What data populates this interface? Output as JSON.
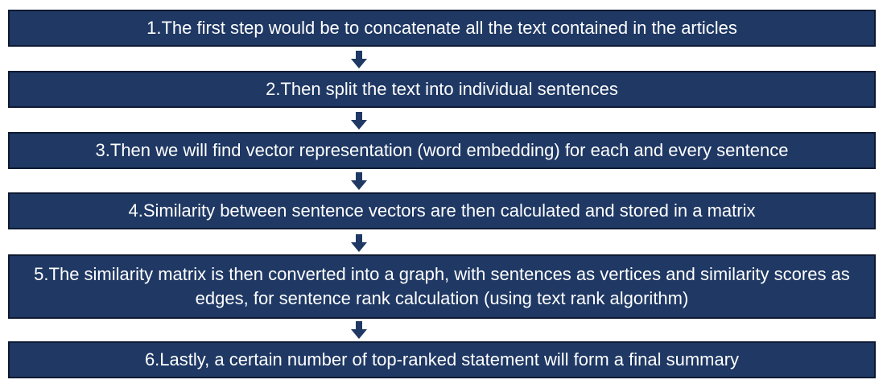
{
  "steps": [
    {
      "text": "1.The first step would be to concatenate all the text contained in the articles"
    },
    {
      "text": "2.Then split the text into individual sentences"
    },
    {
      "text": "3.Then we will find vector representation (word embedding) for each and every sentence"
    },
    {
      "text": "4.Similarity between sentence vectors are then calculated and stored in a matrix"
    },
    {
      "text": "5.The similarity matrix is then converted into a graph, with sentences as vertices and similarity scores as edges, for sentence rank calculation (using text rank algorithm)"
    },
    {
      "text": "6.Lastly, a certain number of top-ranked statement will form a final summary"
    }
  ],
  "colors": {
    "box_fill": "#1f3864",
    "box_border": "#0e1a33",
    "text": "#ffffff",
    "arrow": "#1f3864"
  },
  "icons": {
    "connector": "arrow-down-icon"
  }
}
